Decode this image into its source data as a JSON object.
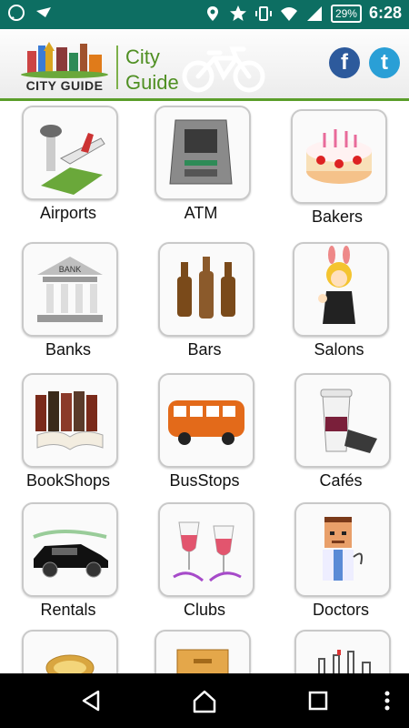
{
  "status": {
    "battery": "29%",
    "time": "6:28"
  },
  "header": {
    "logo_text": "CITY GUIDE",
    "line1": "City",
    "line2": "Guide",
    "fb": "f",
    "tw": "t"
  },
  "categories": [
    {
      "label": "Airports"
    },
    {
      "label": "ATM"
    },
    {
      "label": "Bakers"
    },
    {
      "label": "Banks"
    },
    {
      "label": "Bars"
    },
    {
      "label": "Salons"
    },
    {
      "label": "BookShops"
    },
    {
      "label": "BusStops"
    },
    {
      "label": "Cafés"
    },
    {
      "label": "Rentals"
    },
    {
      "label": "Clubs"
    },
    {
      "label": "Doctors"
    }
  ],
  "icons": {
    "whatsapp": "whatsapp-icon",
    "location": "location-icon",
    "star": "star-icon",
    "vibrate": "vibrate-icon",
    "wifi": "wifi-icon",
    "signal": "signal-icon"
  },
  "colors": {
    "statusbar": "#0d6e62",
    "accent": "#5b9e2a"
  }
}
